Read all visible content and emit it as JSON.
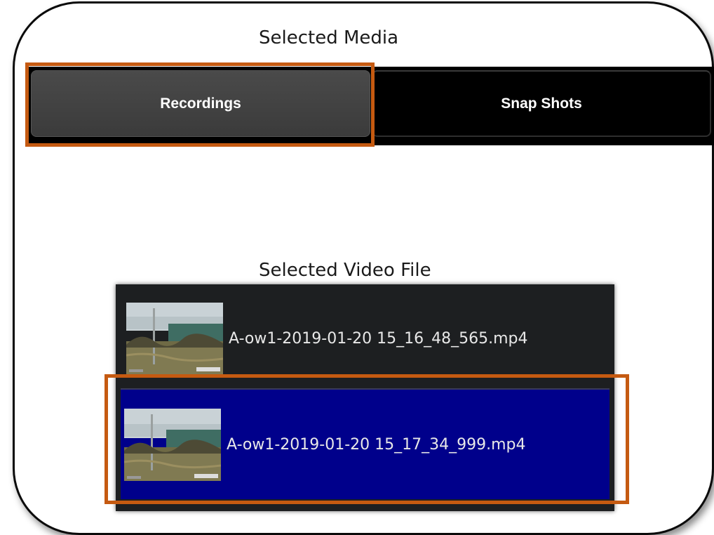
{
  "labels": {
    "selected_media": "Selected Media",
    "selected_video_file": "Selected Video File"
  },
  "tabs": {
    "recordings": "Recordings",
    "snap_shots": "Snap Shots",
    "active": "Recordings"
  },
  "files": [
    {
      "name": "A-ow1-2019-01-20 15_16_48_565.mp4",
      "selected": false
    },
    {
      "name": "A-ow1-2019-01-20 15_17_34_999.mp4",
      "selected": true
    }
  ],
  "colors": {
    "highlight_outline": "#c55a11",
    "selected_row": "#00008b",
    "list_background": "#1d1f21",
    "active_tab": "#444444"
  },
  "icons": {
    "thumbnail": "video-thumbnail-icon"
  }
}
